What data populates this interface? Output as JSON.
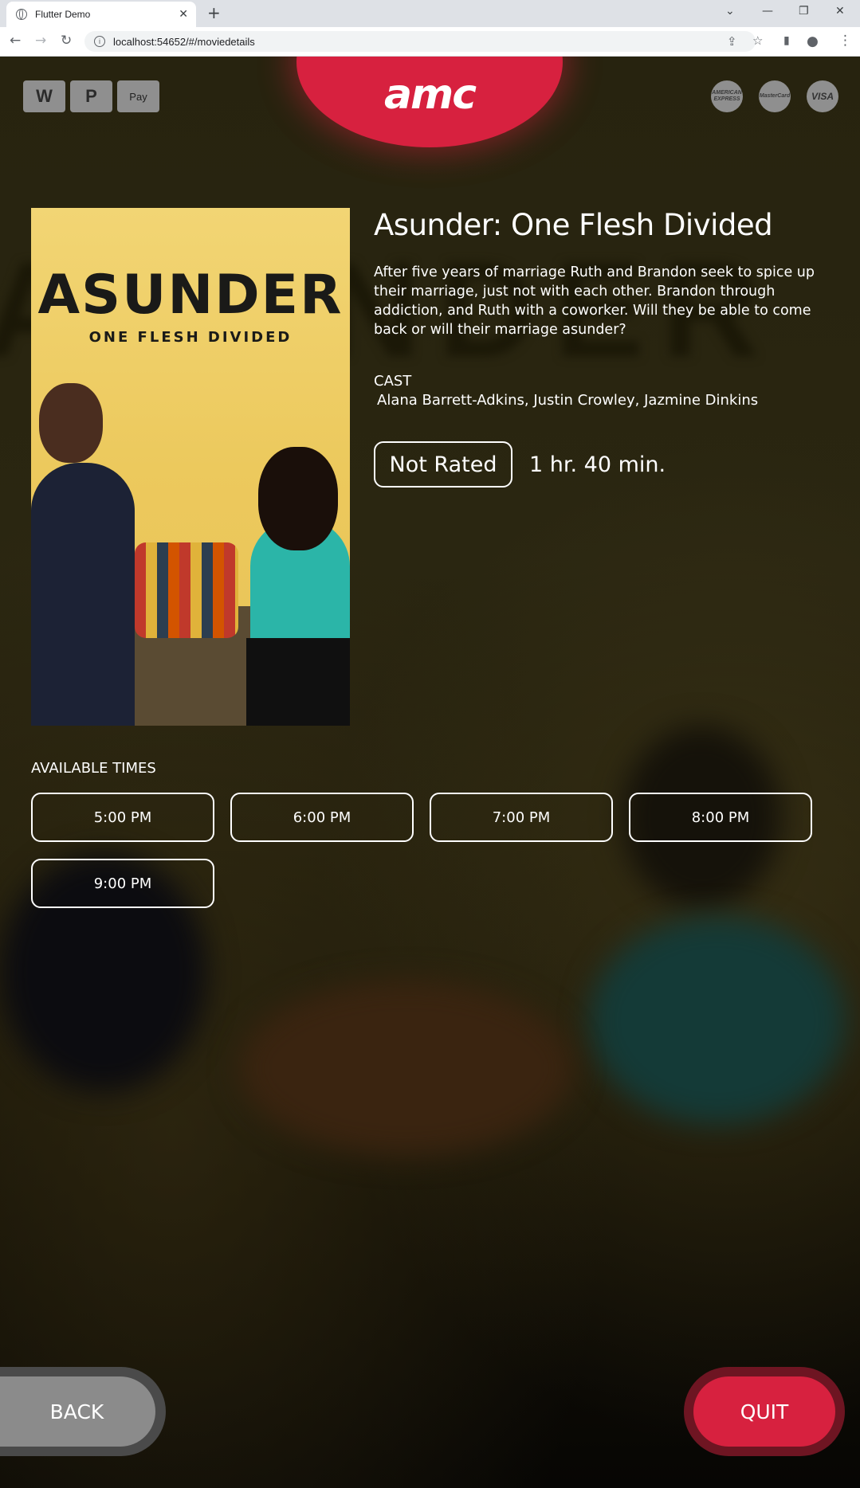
{
  "browser": {
    "tab_title": "Flutter Demo",
    "tab_close": "✕",
    "new_tab": "+",
    "url": "localhost:54652/#/moviedetails",
    "window_controls": [
      "⌄",
      "—",
      "❐",
      "✕"
    ]
  },
  "payments": {
    "left": [
      "W",
      "P",
      " Pay"
    ],
    "right": [
      "AMERICAN EXPRESS",
      "MasterCard",
      "VISA"
    ]
  },
  "brand": {
    "logo": "amc",
    "color": "#d7213f"
  },
  "movie": {
    "poster_title": "ASUNDER",
    "poster_subtitle": "ONE FLESH DIVIDED",
    "title": "Asunder: One Flesh Divided",
    "synopsis": "After five years of marriage Ruth and Brandon seek to spice up their marriage, just not with each other. Brandon through addiction, and Ruth with a coworker. Will they be able to come back or will their marriage asunder?",
    "cast_label": "CAST",
    "cast": " Alana Barrett-Adkins, Justin Crowley, Jazmine Dinkins",
    "rating": "Not Rated",
    "runtime": "1 hr. 40 min."
  },
  "showtimes": {
    "label": "AVAILABLE TIMES",
    "times": [
      "5:00 PM",
      "6:00 PM",
      "7:00 PM",
      "8:00 PM",
      "9:00 PM"
    ]
  },
  "actions": {
    "back": "BACK",
    "quit": "QUIT"
  }
}
